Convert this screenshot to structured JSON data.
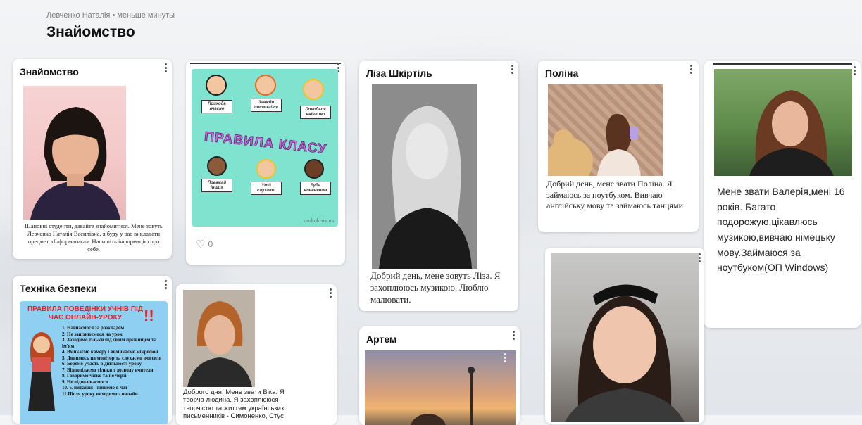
{
  "header": {
    "meta": "Левченко Наталія • меньше минуты",
    "title": "Знайомство"
  },
  "cards": {
    "intro": {
      "title": "Знайомство",
      "caption": "Шановні студенти, давайте знайомитися. Мене зовуть Левченко Наталія Василівна, я буду у вас викладати предмет «Інформатика». Напишіть інформацію про себе."
    },
    "rules": {
      "poster_title": "ПРАВИЛА КЛАСУ",
      "signs": [
        "Приходь вчасно",
        "Завжди посміхайся",
        "Поводься ввічливо",
        "Поважай інших",
        "Умій слухати",
        "Будь впевненим"
      ],
      "watermark": "urokokrok.na",
      "likes": "0"
    },
    "liza": {
      "title": "Ліза Шкіртіль",
      "caption": "Добрий день, мене зовуть Ліза. Я захоплююсь музикою. Люблю малювати."
    },
    "polina": {
      "title": "Поліна",
      "caption": "Добрий день, мене звати Поліна. Я займаюсь за ноутбуком. Вивчаю англійську мову та займаюсь танцями"
    },
    "valeria": {
      "caption": "Мене звати Валерія,мені 16 років. Багато подорожую,цікавлюсь музикою,вивчаю німецьку мову.Займаюся за ноутбуком(ОП Windows)"
    },
    "safety": {
      "title": "Техніка безпеки",
      "poster_title": "ПРАВИЛА ПОВЕДІНКИ УЧНІВ ПІД ЧАС ОНЛАЙН-УРОКУ",
      "items": [
        "1. Навчаємося за розкладом",
        "2. Не запізнюємося на урок",
        "3. Заходимо тільки під своїм прізвищем та ім'ям",
        "4. Вмикаємо камеру і вимикаємо мікрофон",
        "5. Дивимось на монітор та слухаємо вчителя",
        "6. Беремо участь в діяльності уроку",
        "7. Відповідаємо тільки з дозволу вчителя",
        "8. Говоримо чітко та по черзі",
        "9. Не відволікаємося",
        "10. Є питання - пишемо в чат",
        "11.Після уроку виходимо з онлайн"
      ]
    },
    "vika": {
      "caption": "Доброго дня. Мене звати Віка. Я творча людина. Я захоплююся творчістю та життям українських письменників - Симоненко, Стус"
    },
    "artem": {
      "title": "Артем"
    }
  },
  "icons": {
    "kebab": "kebab-menu-icon",
    "heart": "heart-icon"
  },
  "colors": {
    "rules_bg": "#7fe3cf",
    "rules_title": "#c86ad6",
    "safety_bg": "#8fd0f2",
    "safety_title": "#e8202a"
  }
}
